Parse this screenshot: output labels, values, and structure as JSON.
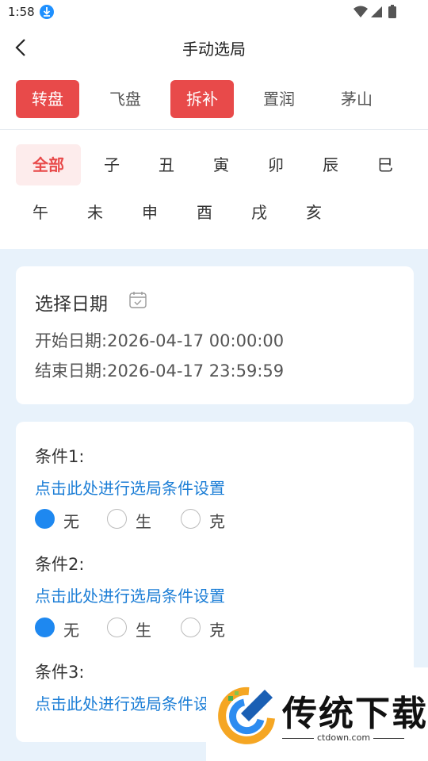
{
  "status": {
    "time": "1:58"
  },
  "header": {
    "title": "手动选局"
  },
  "tabs": [
    {
      "label": "转盘",
      "active": true
    },
    {
      "label": "飞盘",
      "active": false
    },
    {
      "label": "拆补",
      "active": true
    },
    {
      "label": "置润",
      "active": false
    },
    {
      "label": "茅山",
      "active": false
    }
  ],
  "branches": [
    "全部",
    "子",
    "丑",
    "寅",
    "卯",
    "辰",
    "巳",
    "午",
    "未",
    "申",
    "酉",
    "戌",
    "亥"
  ],
  "date_card": {
    "title": "选择日期",
    "start_label": "开始日期:",
    "start_value": "2026-04-17 00:00:00",
    "end_label": "结束日期:",
    "end_value": "2026-04-17 23:59:59"
  },
  "conditions": [
    {
      "label": "条件1:",
      "link": "点击此处进行选局条件设置",
      "options": [
        "无",
        "生",
        "克"
      ],
      "selected": 0
    },
    {
      "label": "条件2:",
      "link": "点击此处进行选局条件设置",
      "options": [
        "无",
        "生",
        "克"
      ],
      "selected": 0
    },
    {
      "label": "条件3:",
      "link": "点击此处进行选局条件设置"
    }
  ],
  "watermark": {
    "name": "传统下载",
    "url": "ctdown.com"
  },
  "colors": {
    "accent_red": "#e84a4a",
    "link_blue": "#1c7ed6",
    "radio_blue": "#1e88f0",
    "bg": "#e8f2fb"
  }
}
